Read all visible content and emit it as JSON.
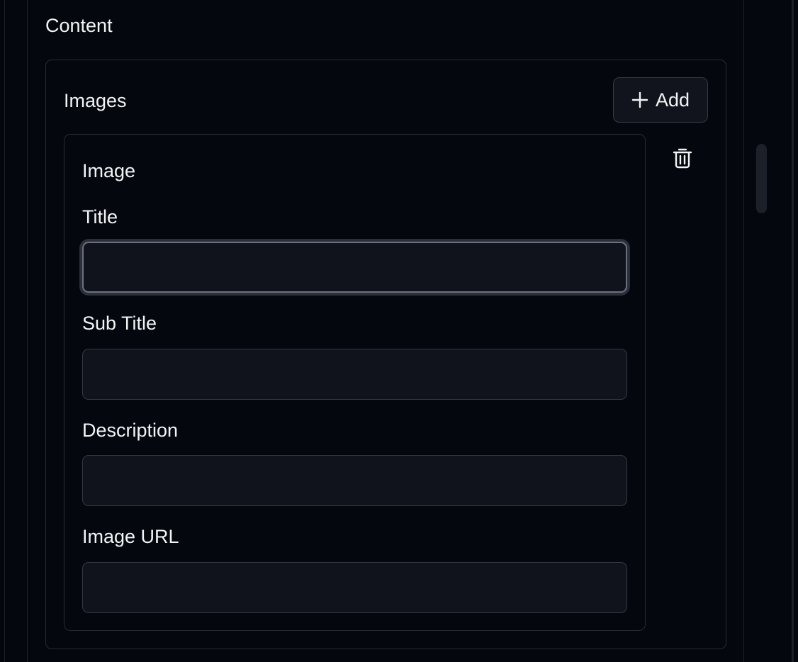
{
  "content": {
    "section_title": "Content",
    "images": {
      "title": "Images",
      "add_button_label": "Add",
      "items": [
        {
          "title": "Image",
          "fields": {
            "title": {
              "label": "Title",
              "value": "",
              "placeholder": ""
            },
            "sub_title": {
              "label": "Sub Title",
              "value": "",
              "placeholder": ""
            },
            "description": {
              "label": "Description",
              "value": "",
              "placeholder": ""
            },
            "image_url": {
              "label": "Image URL",
              "value": "",
              "placeholder": ""
            }
          }
        }
      ]
    }
  },
  "icons": {
    "add": "plus-icon",
    "delete": "trash-icon"
  },
  "colors": {
    "background": "#05070f",
    "border": "#262a34",
    "input_bg": "#10131b",
    "text": "#f3f4f6",
    "focus_ring": "#6b7180"
  }
}
